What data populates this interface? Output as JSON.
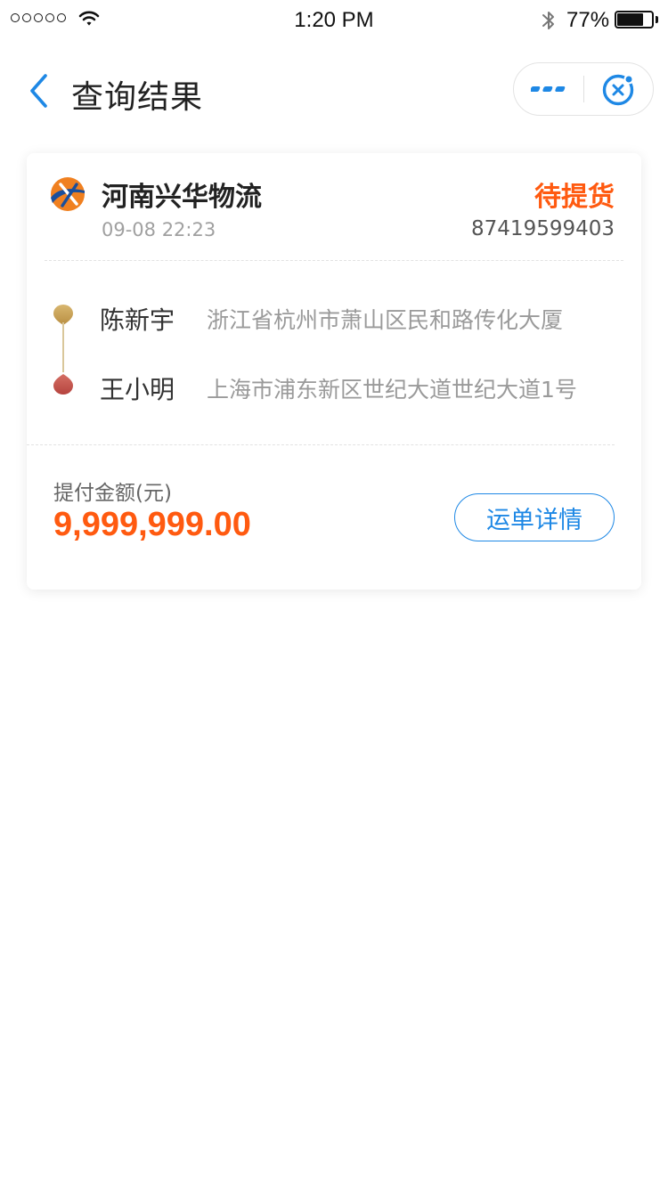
{
  "status_bar": {
    "time": "1:20 PM",
    "battery_percent": "77%",
    "battery_level": 0.77
  },
  "nav": {
    "title": "查询结果",
    "icons": [
      "back-arrow-icon",
      "more-icon",
      "close-circle-icon"
    ]
  },
  "colors": {
    "accent_blue": "#1e88e5",
    "status_orange": "#ff5a10",
    "origin_dot": "#c9a55a",
    "destination_dot": "#c8554f"
  },
  "card": {
    "company": "河南兴华物流",
    "status": "待提货",
    "time": "09-08 22:23",
    "order_no": "87419599403",
    "sender": {
      "name": "陈新宇",
      "address": "浙江省杭州市萧山区民和路传化大厦"
    },
    "receiver": {
      "name": "王小明",
      "address": "上海市浦东新区世纪大道世纪大道1号"
    },
    "amount_label": "提付金额(元)",
    "amount_value": "9,999,999.00",
    "detail_button": "运单详情"
  }
}
